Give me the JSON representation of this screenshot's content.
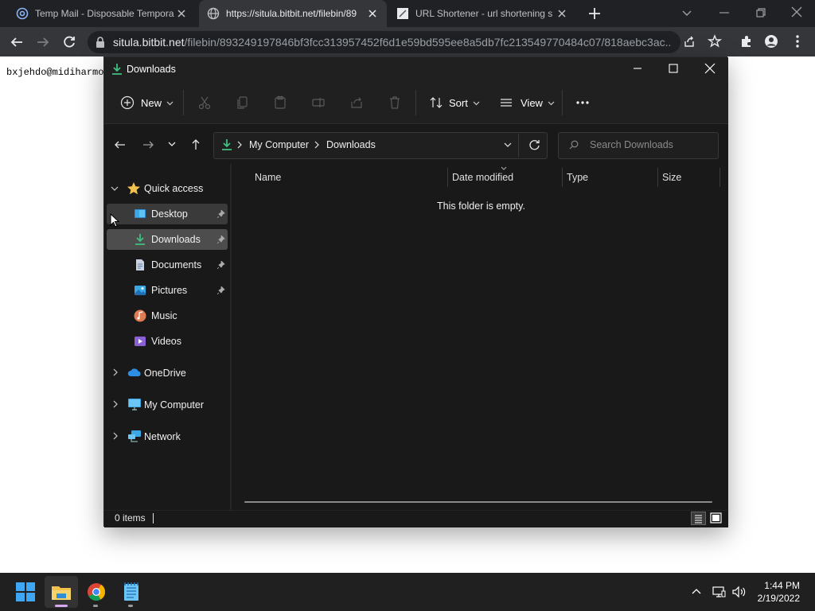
{
  "browser": {
    "tabs": [
      {
        "title": "Temp Mail - Disposable Tempora",
        "favicon": "at-sign-icon",
        "active": false
      },
      {
        "title": "https://situla.bitbit.net/filebin/89",
        "favicon": "globe-icon",
        "active": true
      },
      {
        "title": "URL Shortener - url shortening s",
        "favicon": "link-icon",
        "active": false
      }
    ],
    "url_host": "situla.bitbit.net",
    "url_path": "/filebin/893249197846bf3fcc313957452f6d1e59bd595ee8a5db7fc213549770484c07/818aebc3ac..."
  },
  "page": {
    "text": "bxjehdo@midiharmo"
  },
  "explorer": {
    "title": "Downloads",
    "toolbar": {
      "new_label": "New",
      "sort_label": "Sort",
      "view_label": "View"
    },
    "breadcrumb": [
      "My Computer",
      "Downloads"
    ],
    "search_placeholder": "Search Downloads",
    "sidebar": {
      "quick_access": "Quick access",
      "quick_items": [
        {
          "label": "Desktop",
          "icon": "desktop-icon",
          "pinned": true
        },
        {
          "label": "Downloads",
          "icon": "download-icon",
          "pinned": true
        },
        {
          "label": "Documents",
          "icon": "document-icon",
          "pinned": true
        },
        {
          "label": "Pictures",
          "icon": "pictures-icon",
          "pinned": true
        },
        {
          "label": "Music",
          "icon": "music-icon",
          "pinned": false
        },
        {
          "label": "Videos",
          "icon": "video-icon",
          "pinned": false
        }
      ],
      "roots": [
        {
          "label": "OneDrive",
          "icon": "cloud-icon"
        },
        {
          "label": "My Computer",
          "icon": "computer-icon"
        },
        {
          "label": "Network",
          "icon": "network-icon"
        }
      ]
    },
    "columns": [
      "Name",
      "Date modified",
      "Type",
      "Size"
    ],
    "empty_message": "This folder is empty.",
    "status_items": "0 items"
  },
  "taskbar": {
    "time": "1:44 PM",
    "date": "2/19/2022"
  },
  "colors": {
    "accent": "#4cc2ff",
    "download_green": "#3fbf7f",
    "folder_yellow": "#f2c14e"
  }
}
